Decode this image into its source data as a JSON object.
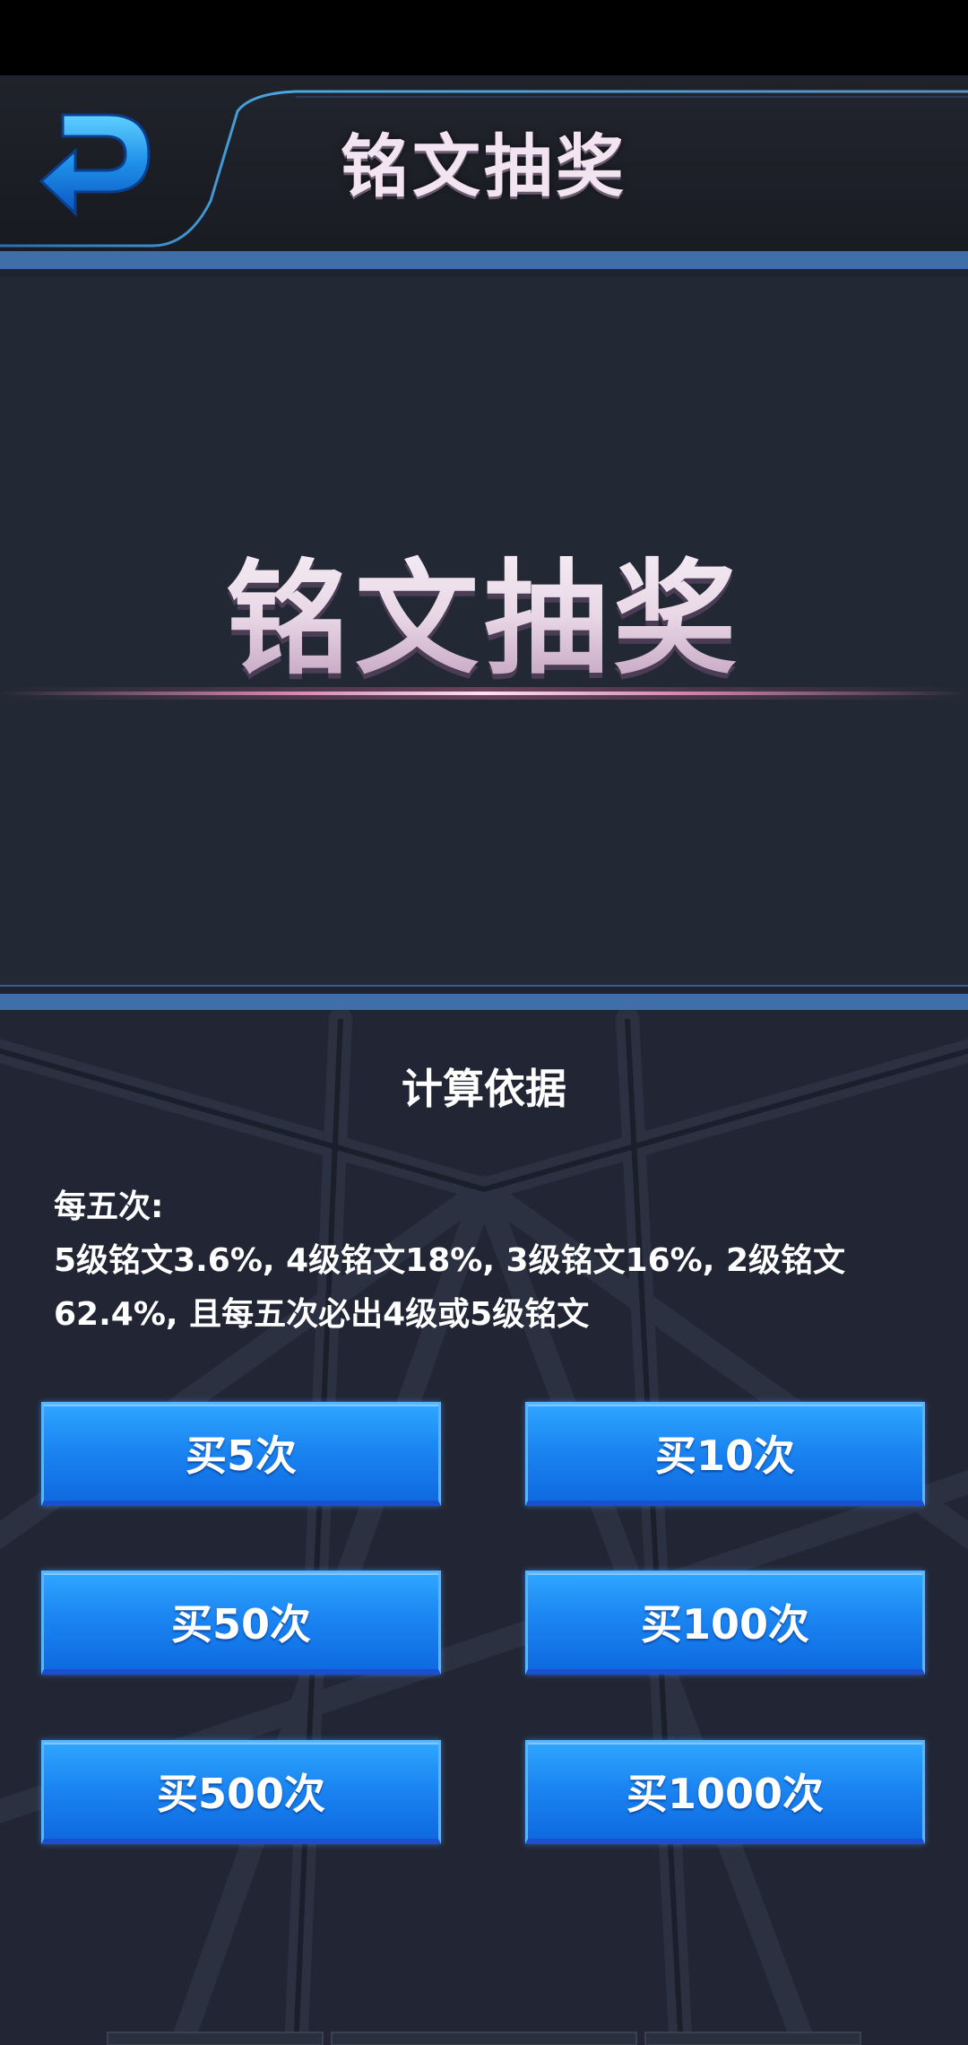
{
  "header": {
    "title": "铭文抽奖",
    "back_icon": "back-arrow-icon"
  },
  "banner": {
    "title": "铭文抽奖"
  },
  "calculation": {
    "title": "计算依据",
    "lines": [
      "每五次:",
      "5级铭文3.6%, 4级铭文18%, 3级铭文16%, 2级铭文",
      "62.4%, 且每五次必出4级或5级铭文"
    ]
  },
  "buttons": [
    {
      "label": "买5次"
    },
    {
      "label": "买10次"
    },
    {
      "label": "买50次"
    },
    {
      "label": "买100次"
    },
    {
      "label": "买500次"
    },
    {
      "label": "买1000次"
    }
  ],
  "colors": {
    "accent_blue": "#1b86f2",
    "band_blue": "#3f6ea8",
    "title_pink": "#e9d7e6"
  }
}
